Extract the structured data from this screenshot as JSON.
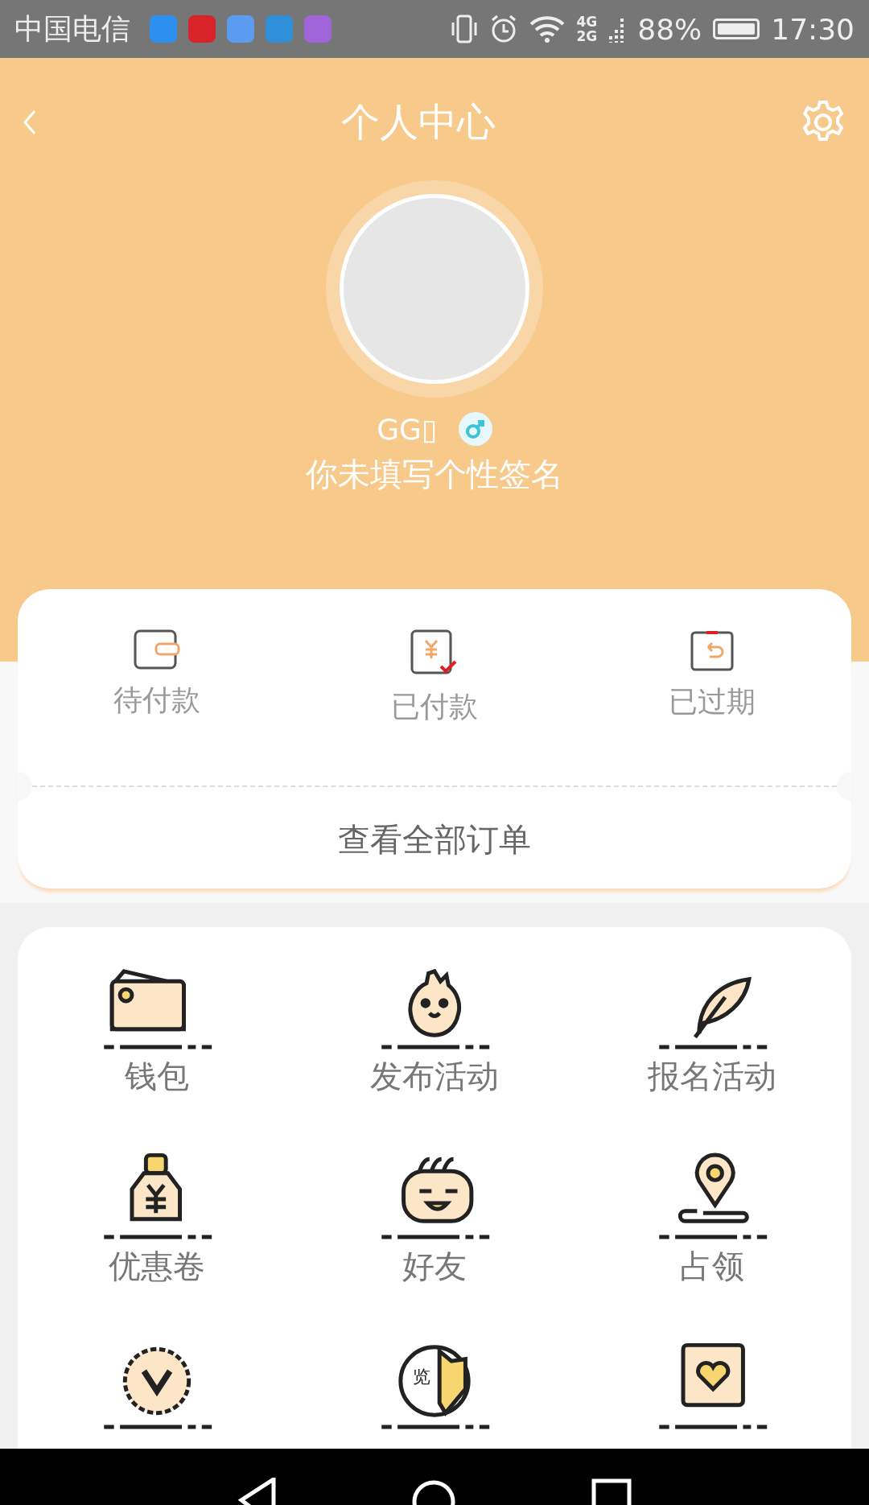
{
  "status_bar": {
    "carrier": "中国电信",
    "apps": [
      {
        "color": "#2d8ff0"
      },
      {
        "color": "#d8232a"
      },
      {
        "color": "#5b9cf0"
      },
      {
        "color": "#2f8fd8"
      },
      {
        "color": "#a065d8"
      }
    ],
    "network_top": "4G",
    "network_bottom": "2G",
    "battery_percent": "88%",
    "time": "17:30"
  },
  "header": {
    "title": "个人中心"
  },
  "profile": {
    "name": "GG▯",
    "signature": "你未填写个性签名"
  },
  "orders": {
    "items": [
      {
        "kind": "unpaid",
        "label": "待付款"
      },
      {
        "kind": "paid",
        "label": "已付款"
      },
      {
        "kind": "expired",
        "label": "已过期"
      }
    ],
    "all_orders": "查看全部订单"
  },
  "grid": [
    {
      "kind": "wallet",
      "label": "钱包"
    },
    {
      "kind": "egg",
      "label": "发布活动"
    },
    {
      "kind": "feather",
      "label": "报名活动"
    },
    {
      "kind": "bottle",
      "label": "优惠卷"
    },
    {
      "kind": "face",
      "label": "好友"
    },
    {
      "kind": "pin",
      "label": "占领"
    },
    {
      "kind": "badge"
    },
    {
      "kind": "lan",
      "glyph": "览"
    },
    {
      "kind": "book"
    }
  ]
}
